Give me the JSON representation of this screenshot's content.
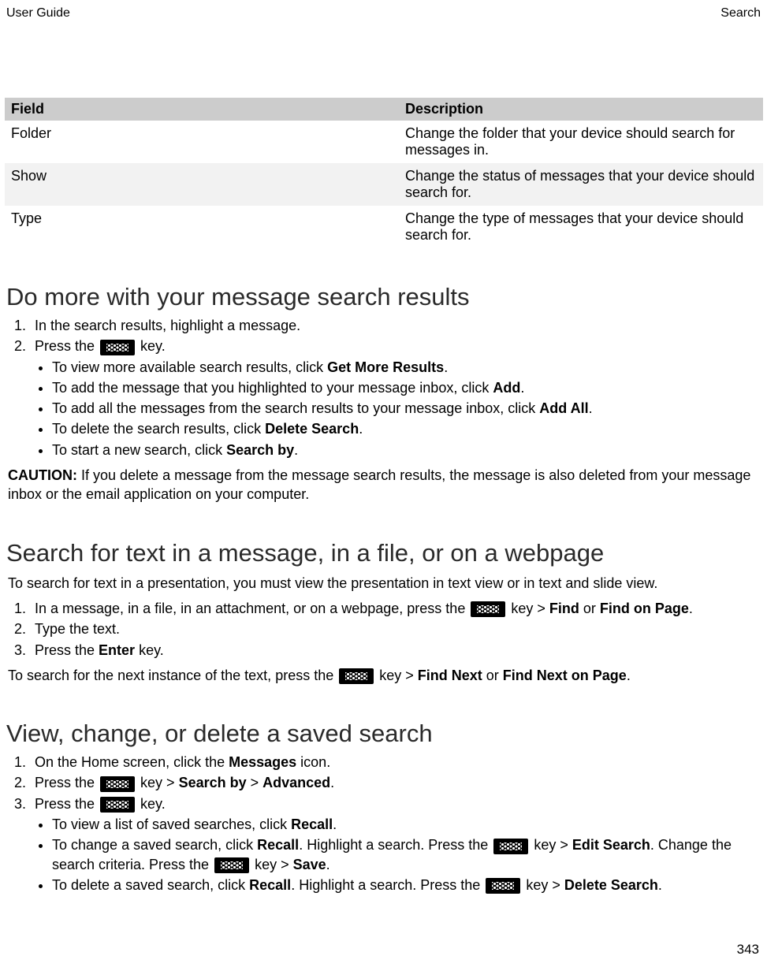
{
  "header": {
    "left": "User Guide",
    "right": "Search"
  },
  "table": {
    "col1": "Field",
    "col2": "Description",
    "rows": [
      {
        "f": "Folder",
        "d": "Change the folder that your device should search for messages in."
      },
      {
        "f": "Show",
        "d": "Change the status of messages that your device should search for."
      },
      {
        "f": "Type",
        "d": "Change the type of messages that your device should search for."
      }
    ]
  },
  "s1": {
    "title": "Do more with your message search results",
    "li1": "In the search results, highlight a message.",
    "li2a": "Press the ",
    "li2b": " key.",
    "b1a": "To view more available search results, click ",
    "b1b": "Get More Results",
    "b1c": ".",
    "b2a": "To add the message that you highlighted to your message inbox, click ",
    "b2b": "Add",
    "b2c": ".",
    "b3a": "To add all the messages from the search results to your message inbox, click ",
    "b3b": "Add All",
    "b3c": ".",
    "b4a": "To delete the search results, click ",
    "b4b": "Delete Search",
    "b4c": ".",
    "b5a": "To start a new search, click ",
    "b5b": "Search by",
    "b5c": ".",
    "caution_label": "CAUTION:",
    "caution": " If you delete a message from the message search results, the message is also deleted from your message inbox or the email application on your computer."
  },
  "s2": {
    "title": "Search for text in a message, in a file, or on a webpage",
    "intro": "To search for text in a presentation, you must view the presentation in text view or in text and slide view.",
    "li1a": "In a message, in a file, in an attachment, or on a webpage, press the ",
    "li1b": " key > ",
    "li1c": "Find",
    "li1d": " or ",
    "li1e": "Find on Page",
    "li1f": ".",
    "li2": "Type the text.",
    "li3a": "Press the ",
    "li3b": "Enter",
    "li3c": " key.",
    "nexta": "To search for the next instance of the text, press the ",
    "nextb": " key > ",
    "nextc": "Find Next",
    "nextd": " or ",
    "nexte": "Find Next on Page",
    "nextf": "."
  },
  "s3": {
    "title": "View, change, or delete a saved search",
    "li1a": "On the Home screen, click the ",
    "li1b": "Messages",
    "li1c": " icon.",
    "li2a": "Press the ",
    "li2b": " key > ",
    "li2c": "Search by",
    "li2d": " > ",
    "li2e": "Advanced",
    "li2f": ".",
    "li3a": "Press the ",
    "li3b": " key.",
    "b1a": "To view a list of saved searches, click ",
    "b1b": "Recall",
    "b1c": ".",
    "b2a": "To change a saved search, click ",
    "b2b": "Recall",
    "b2c": ". Highlight a search. Press the ",
    "b2d": " key > ",
    "b2e": "Edit Search",
    "b2f": ". Change the search criteria. Press the ",
    "b2g": " key > ",
    "b2h": "Save",
    "b2i": ".",
    "b3a": "To delete a saved search, click ",
    "b3b": "Recall",
    "b3c": ". Highlight a search. Press the ",
    "b3d": " key > ",
    "b3e": "Delete Search",
    "b3f": "."
  },
  "page": "343"
}
